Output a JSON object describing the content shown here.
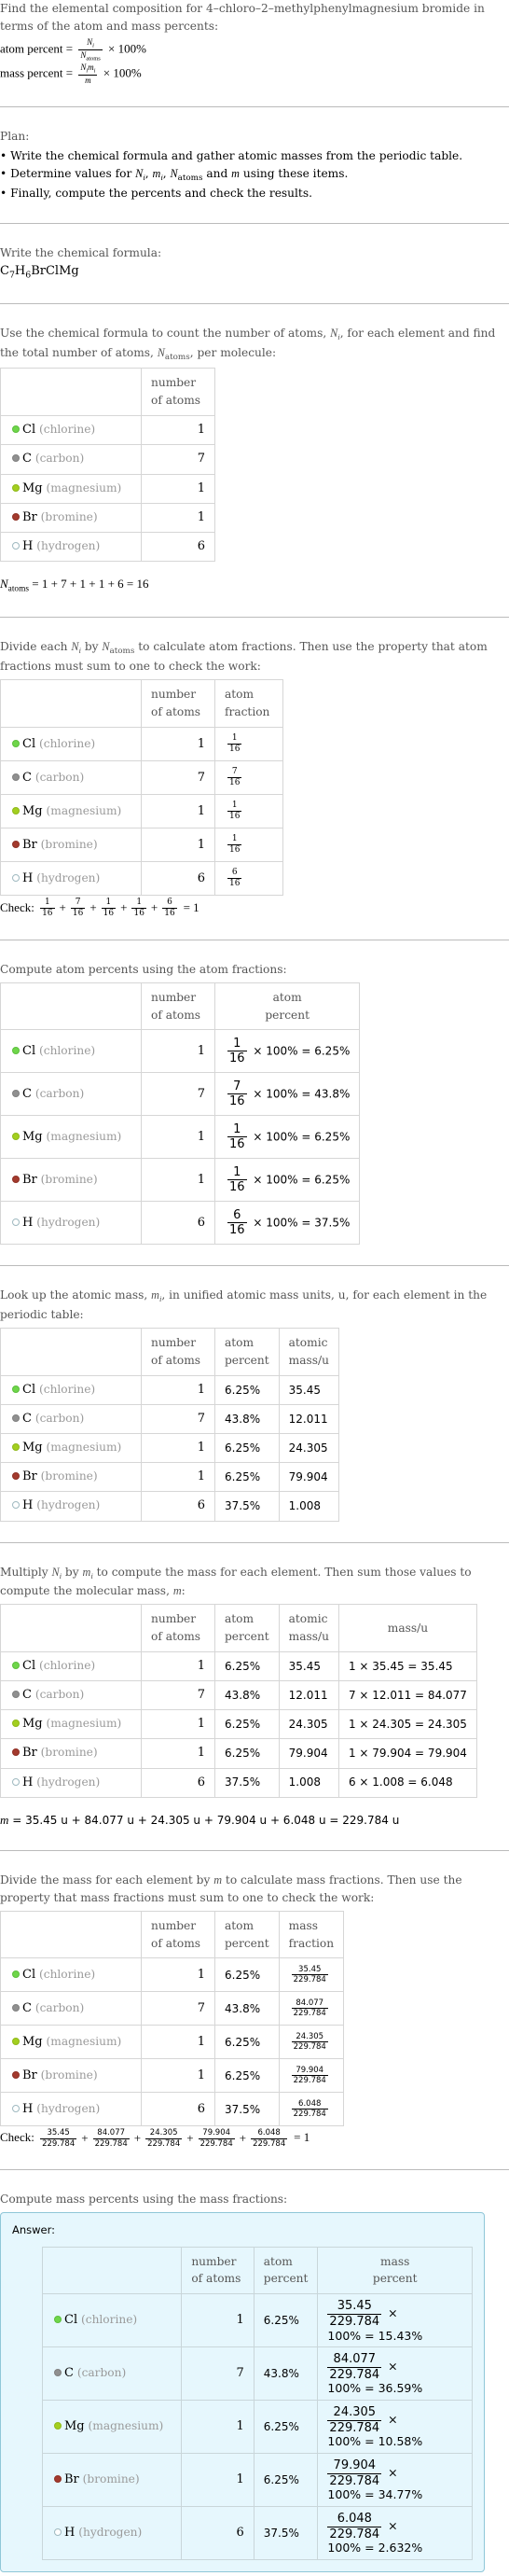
{
  "intro": {
    "line1": "Find the elemental composition for 4–chloro–2–methylphenylmagnesium bromide in terms of the atom and mass percents:",
    "atom_percent_label": "atom percent = ",
    "mass_percent_label": "mass percent = ",
    "atom_num": "N",
    "atom_num_sub": "i",
    "atom_den": "N",
    "atom_den_sub": "atoms",
    "mass_num": "N",
    "mass_num_sub": "i",
    "mass_num2": "m",
    "mass_num2_sub": "i",
    "mass_den": "m",
    "times_100": "× 100%"
  },
  "plan": {
    "title": "Plan:",
    "items": [
      "• Write the chemical formula and gather atomic masses from the periodic table.",
      "• Determine values for N_i, m_i, N_atoms and m using these items.",
      "• Finally, compute the percents and check the results."
    ],
    "item2_prefix": "• Determine values for ",
    "item2_suffix": " using these items."
  },
  "formula_step": {
    "title": "Write the chemical formula:",
    "formula_parts": [
      "C",
      "7",
      "H",
      "6",
      "BrClMg"
    ]
  },
  "count_step": {
    "text_a": "Use the chemical formula to count the number of atoms, ",
    "text_b": ", for each element and find the total number of atoms, ",
    "text_c": ", per molecule:",
    "total_eq": " = 1 + 7 + 1 + 1 + 6 = 16"
  },
  "headers": {
    "number_of_atoms": [
      "number",
      "of atoms"
    ],
    "atom_fraction": [
      "atom",
      "fraction"
    ],
    "atom_percent": [
      "atom",
      "percent"
    ],
    "atomic_mass": [
      "atomic",
      "mass/u"
    ],
    "mass": "mass/u",
    "mass_fraction": [
      "mass",
      "fraction"
    ],
    "mass_percent": [
      "mass",
      "percent"
    ]
  },
  "elements": [
    {
      "symbol": "Cl",
      "name": "(chlorine)",
      "color": "#6fd64a",
      "border": "#5cbf3c",
      "count": "1",
      "frac_num": "1",
      "frac_den": "16",
      "atom_percent": "6.25%",
      "atomic_mass": "35.45",
      "mass_calc": "1 × 35.45 = 35.45",
      "mass": "35.45",
      "mass_percent": "15.43%",
      "atom_percent_calc": "× 100% = 6.25%"
    },
    {
      "symbol": "C",
      "name": "(carbon)",
      "color": "#909090",
      "border": "#808080",
      "count": "7",
      "frac_num": "7",
      "frac_den": "16",
      "atom_percent": "43.8%",
      "atomic_mass": "12.011",
      "mass_calc": "7 × 12.011 = 84.077",
      "mass": "84.077",
      "mass_percent": "36.59%",
      "atom_percent_calc": "× 100% = 43.8%"
    },
    {
      "symbol": "Mg",
      "name": "(magnesium)",
      "color": "#a3cf1f",
      "border": "#8fb91a",
      "count": "1",
      "frac_num": "1",
      "frac_den": "16",
      "atom_percent": "6.25%",
      "atomic_mass": "24.305",
      "mass_calc": "1 × 24.305 = 24.305",
      "mass": "24.305",
      "mass_percent": "10.58%",
      "atom_percent_calc": "× 100% = 6.25%"
    },
    {
      "symbol": "Br",
      "name": "(bromine)",
      "color": "#a33a2e",
      "border": "#8f3025",
      "count": "1",
      "frac_num": "1",
      "frac_den": "16",
      "atom_percent": "6.25%",
      "atomic_mass": "79.904",
      "mass_calc": "1 × 79.904 = 79.904",
      "mass": "79.904",
      "mass_percent": "34.77%",
      "atom_percent_calc": "× 100% = 6.25%"
    },
    {
      "symbol": "H",
      "name": "(hydrogen)",
      "color": "#ffffff",
      "border": "#9fb9c0",
      "count": "6",
      "frac_num": "6",
      "frac_den": "16",
      "atom_percent": "37.5%",
      "atomic_mass": "1.008",
      "mass_calc": "6 × 1.008 = 6.048",
      "mass": "6.048",
      "mass_percent": "2.632%",
      "atom_percent_calc": "× 100% = 37.5%"
    }
  ],
  "fraction_step": {
    "text_a": "Divide each ",
    "text_b": " by ",
    "text_c": " to calculate atom fractions. Then use the property that atom fractions must sum to one to check the work:",
    "check_label": "Check: ",
    "check_result": "= 1"
  },
  "atom_percent_step": {
    "text": "Compute atom percents using the atom fractions:"
  },
  "atomic_mass_step": {
    "text_a": "Look up the atomic mass, ",
    "text_b": ", in unified atomic mass units, u, for each element in the periodic table:"
  },
  "mass_step": {
    "text_a": "Multiply ",
    "text_b": " by ",
    "text_c": " to compute the mass for each element. Then sum those values to compute the molecular mass, ",
    "text_d": ":",
    "total_eq": " = 35.45 u + 84.077 u + 24.305 u + 79.904 u + 6.048 u = 229.784 u",
    "molecular_mass": "229.784"
  },
  "mass_fraction_step": {
    "text_a": "Divide the mass for each element by ",
    "text_b": " to calculate mass fractions. Then use the property that mass fractions must sum to one to check the work:",
    "check_label": "Check: ",
    "check_result": "= 1"
  },
  "mass_percent_step": {
    "text": "Compute mass percents using the mass fractions:",
    "answer_label": "Answer:",
    "times": "×",
    "hundred_eq": "100% = "
  },
  "symbols": {
    "N": "N",
    "m": "m",
    "i": "i",
    "atoms": "atoms",
    "plus": "+"
  }
}
